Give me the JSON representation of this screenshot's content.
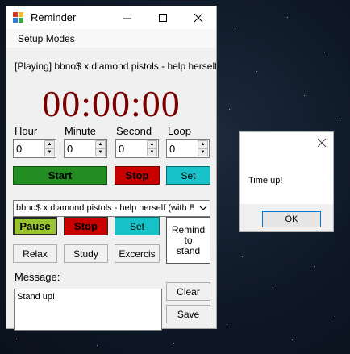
{
  "window": {
    "title": "Reminder",
    "menu": [
      "Setup Modes"
    ]
  },
  "player": {
    "now_playing": "[Playing] bbno$ x diamond pistols - help herself (with BEN"
  },
  "timer": {
    "display": "00:00:00"
  },
  "fields": [
    {
      "label": "Hour",
      "value": "0"
    },
    {
      "label": "Minute",
      "value": "0"
    },
    {
      "label": "Second",
      "value": "0"
    },
    {
      "label": "Loop",
      "value": "0"
    }
  ],
  "buttons": {
    "start": "Start",
    "stop": "Stop",
    "set": "Set",
    "pause": "Pause",
    "stop2": "Stop",
    "set2": "Set",
    "relax": "Relax",
    "study": "Study",
    "exercise": "Excercis",
    "remind_to_stand": "Remind to stand",
    "clear": "Clear",
    "save": "Save"
  },
  "track_select": {
    "selected": "bbno$ x diamond pistols - help herself (with BEN"
  },
  "message": {
    "label": "Message:",
    "text": "Stand up!"
  },
  "dialog": {
    "text": "Time up!",
    "ok": "OK"
  },
  "colors": {
    "start_green": "#238c23",
    "stop_red": "#c80000",
    "set_cyan": "#17c3c8",
    "pause_olive": "#9ac42e",
    "timer_maroon": "#7a0000"
  }
}
